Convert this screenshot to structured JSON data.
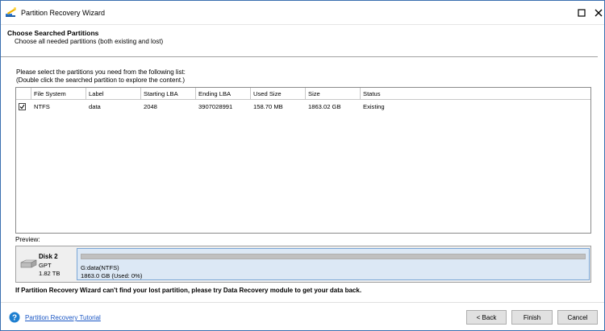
{
  "window": {
    "title": "Partition Recovery Wizard"
  },
  "header": {
    "heading": "Choose Searched Partitions",
    "subheading": "Choose all needed partitions (both existing and lost)"
  },
  "instructions": {
    "line1": "Please select the partitions you need from the following list:",
    "line2": "(Double click the searched partition to explore the content.)"
  },
  "table": {
    "columns": [
      "File System",
      "Label",
      "Starting LBA",
      "Ending LBA",
      "Used Size",
      "Size",
      "Status"
    ],
    "rows": [
      {
        "checked": true,
        "cells": [
          "NTFS",
          "data",
          "2048",
          "3907028991",
          "158.70 MB",
          "1863.02 GB",
          "Existing"
        ]
      }
    ]
  },
  "preview": {
    "label": "Preview:",
    "disk": {
      "name": "Disk 2",
      "type": "GPT",
      "size": "1.82 TB"
    },
    "partition": {
      "name": "G:data(NTFS)",
      "size_text": "1863.0 GB (Used: 0%)",
      "used_fraction": 0.0
    }
  },
  "warning": "If Partition Recovery Wizard can't find your lost partition, please try Data Recovery module to get your data back.",
  "footer": {
    "tutorial_link": "Partition Recovery Tutorial",
    "back_label": "< Back",
    "finish_label": "Finish",
    "cancel_label": "Cancel"
  },
  "colors": {
    "link": "#1a56c4",
    "help_icon": "#1e7fd0",
    "partition_fill": "#dce8f5",
    "usage_bar": "#c0c0c0"
  },
  "icons": {
    "app": "wizard-icon",
    "maximize": "maximize-icon",
    "close": "close-icon",
    "disk": "disk-icon",
    "help": "help-icon",
    "checkbox": "checkmark-icon"
  }
}
